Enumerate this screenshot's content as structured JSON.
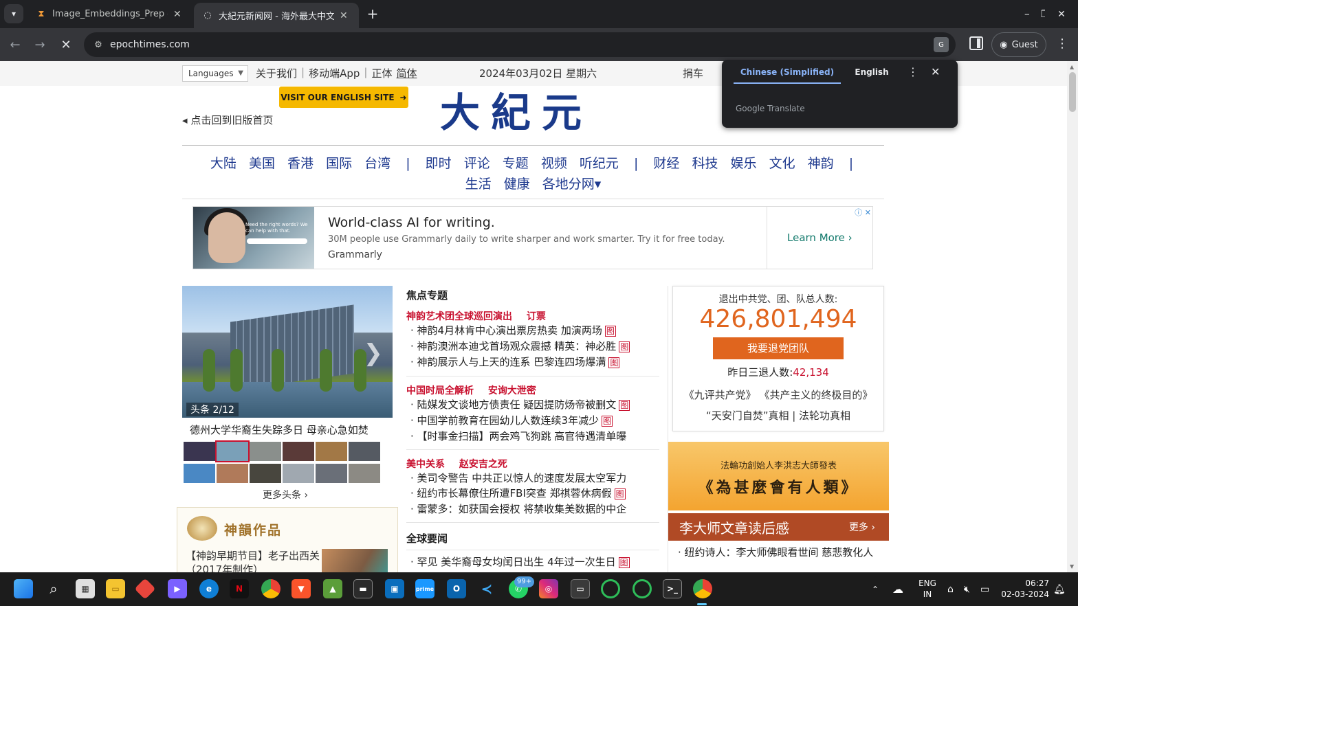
{
  "browser": {
    "tabs": [
      {
        "title": "Image_Embeddings_Prep - Jupy",
        "icon": "hourglass-icon"
      },
      {
        "title": "大紀元新闻网 - 海外最大中文媒",
        "icon": "loading-icon",
        "active": true
      }
    ],
    "url": "epochtimes.com",
    "profile_label": "Guest"
  },
  "translate_popup": {
    "source_lang": "Chinese (Simplified)",
    "target_lang": "English",
    "brand": "Google Translate"
  },
  "page": {
    "topbar": {
      "languages_label": "Languages",
      "links": [
        "关于我们",
        "移动端App",
        "正体",
        "简体"
      ],
      "date": "2024年03月02日 星期六",
      "donate": "捐车"
    },
    "english_button": "VISIT OUR ENGLISH SITE",
    "old_home_link": "点击回到旧版首页",
    "logo_text": "大紀元",
    "nav_row1": [
      "大陆",
      "美国",
      "香港",
      "国际",
      "台湾",
      "|",
      "即时",
      "评论",
      "专题",
      "视频",
      "听纪元",
      "|",
      "财经",
      "科技",
      "娱乐",
      "文化",
      "神韵",
      "|"
    ],
    "nav_row2": [
      "生活",
      "健康",
      "各地分网▾"
    ],
    "ad": {
      "image_text": "Need the right words? We can help with that.",
      "title": "World-class AI for writing.",
      "desc": "30M people use Grammarly daily to write sharper and work smarter. Try it for free today.",
      "brand": "Grammarly",
      "cta": "Learn More"
    },
    "headline": {
      "counter": "头条 2/12",
      "caption": "德州大学华裔生失踪多日  母亲心急如焚",
      "more": "更多头条"
    },
    "shenyun_box": {
      "title": "神韻作品",
      "text": "【神韵早期节目】老子出西关（2017年制作）"
    },
    "focus": {
      "title": "焦点专题",
      "groups": [
        {
          "heads": [
            "神韵艺术团全球巡回演出",
            "订票"
          ],
          "items": [
            {
              "text": "· 神韵4月林肯中心演出票房热卖  加演两场",
              "pic": "图"
            },
            {
              "text": "· 神韵澳洲本迪戈首场观众震撼  精英：神必胜",
              "pic": "图"
            },
            {
              "text": "· 神韵展示人与上天的连系  巴黎连四场爆满",
              "pic": "图"
            }
          ]
        },
        {
          "heads": [
            "中国时局全解析",
            "安询大泄密"
          ],
          "items": [
            {
              "text": "· 陆媒发文谈地方债责任  疑因提防炀帝被删文",
              "pic": "图"
            },
            {
              "text": "· 中国学前教育在园幼儿人数连续3年减少",
              "pic": "图"
            },
            {
              "text": "· 【时事金扫描】两会鸡飞狗跳  高官待遇清单曝",
              "pic": ""
            }
          ]
        },
        {
          "heads": [
            "美中关系",
            "赵安吉之死"
          ],
          "items": [
            {
              "text": "· 美司令警告  中共正以惊人的速度发展太空军力",
              "pic": ""
            },
            {
              "text": "· 纽约市长幕僚住所遭FBI突查  郑祺蓉休病假",
              "pic": "图"
            },
            {
              "text": "· 雷蒙多：如获国会授权  将禁收集美数据的中企",
              "pic": ""
            }
          ]
        }
      ],
      "global_title": "全球要闻",
      "global_items": [
        {
          "text": "· 罕见  美华裔母女均闰日出生  4年过一次生日",
          "pic": "图"
        }
      ]
    },
    "quit_panel": {
      "label": "退出中共党、团、队总人数:",
      "total": "426,801,494",
      "button": "我要退党团队",
      "yesterday_label": "昨日三退人数:",
      "yesterday_value": "42,134",
      "links_row1": "《九评共产党》  《共产主义的终极目的》",
      "links_row2": "“天安门自焚”真相     |     法轮功真相"
    },
    "banner": {
      "line1": "法輪功創始人李洪志大師發表",
      "line2": "《為甚麼會有人類》"
    },
    "lih_bar": {
      "title": "李大师文章读后感",
      "more": "更多"
    },
    "lih_item": "· 纽约诗人：李大师佛眼看世间  慈悲教化人"
  },
  "taskbar": {
    "lang": "ENG",
    "region": "IN",
    "time": "06:27",
    "date": "02-03-2024",
    "whatsapp_badge": "99+"
  },
  "colors": {
    "chrome_dark": "#202124",
    "nav_blue": "#1f3a8f",
    "epoch_red": "#c8102e",
    "quit_orange": "#e0651e",
    "translate_blue": "#8ab4f8"
  }
}
